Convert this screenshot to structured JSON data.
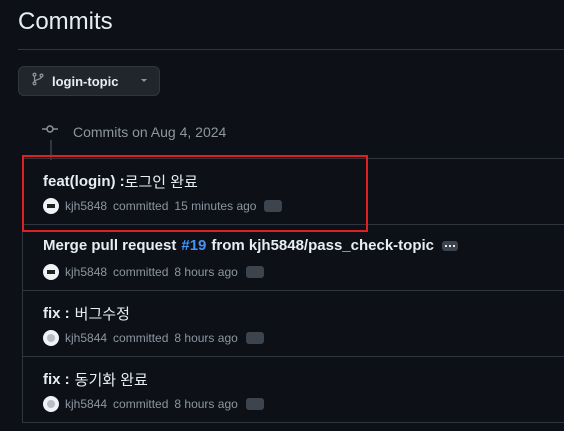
{
  "header": {
    "title": "Commits"
  },
  "branch": {
    "name": "login-topic"
  },
  "group": {
    "date_label": "Commits on Aug 4, 2024"
  },
  "commits": [
    {
      "title_prefix": "feat(login) :",
      "title_korean": "로그인 완료",
      "author": "kjh5848",
      "action": "committed",
      "time": "15 minutes ago"
    },
    {
      "title_prefix": "Merge pull request",
      "pr": "#19",
      "title_suffix": "from kjh5848/pass_check-topic",
      "author": "kjh5848",
      "action": "committed",
      "time": "8 hours ago"
    },
    {
      "title_prefix": "fix :",
      "title_korean": "버그수정",
      "author": "kjh5844",
      "action": "committed",
      "time": "8 hours ago"
    },
    {
      "title_prefix": "fix :",
      "title_korean": "동기화 완료",
      "author": "kjh5844",
      "action": "committed",
      "time": "8 hours ago"
    }
  ],
  "colors": {
    "background": "#0d1117",
    "link": "#4493f8",
    "highlight": "#e02020"
  }
}
